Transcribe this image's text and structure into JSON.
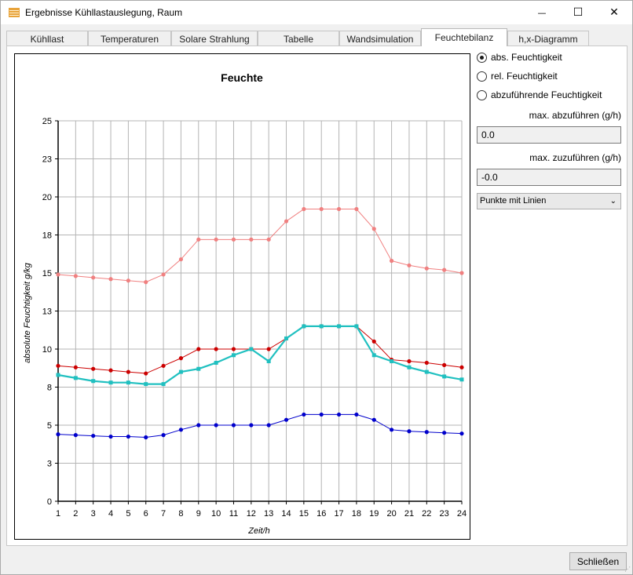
{
  "window": {
    "title": "Ergebnisse Kühllastauslegung, Raum",
    "minimize_glyph": "—",
    "maximize_glyph": "☐",
    "close_glyph": "✕",
    "app_icon": "app-grid-icon"
  },
  "tabs": [
    {
      "label": "Kühllast"
    },
    {
      "label": "Temperaturen"
    },
    {
      "label": "Solare Strahlung"
    },
    {
      "label": "Tabelle"
    },
    {
      "label": "Wandsimulation"
    },
    {
      "label": "Feuchtebilanz",
      "active": true
    },
    {
      "label": "h,x-Diagramm"
    }
  ],
  "options": {
    "radios": [
      {
        "label": "abs. Feuchtigkeit",
        "checked": true
      },
      {
        "label": "rel. Feuchtigkeit",
        "checked": false
      },
      {
        "label": "abzuführende Feuchtigkeit",
        "checked": false
      }
    ],
    "max_remove_label": "max. abzuführen (g/h)",
    "max_remove_value": "0.0",
    "max_add_label": "max. zuzuführen (g/h)",
    "max_add_value": "-0.0",
    "display_mode": "Punkte mit Linien"
  },
  "footer": {
    "close_label": "Schließen"
  },
  "chart_data": {
    "type": "line",
    "title": "Feuchte",
    "xlabel": "Zeit/h",
    "ylabel": "absolute Feuchtigkeit g/kg",
    "x": [
      1,
      2,
      3,
      4,
      5,
      6,
      7,
      8,
      9,
      10,
      11,
      12,
      13,
      14,
      15,
      16,
      17,
      18,
      19,
      20,
      21,
      22,
      23,
      24
    ],
    "xlim": [
      1,
      24
    ],
    "ylim": [
      0,
      25
    ],
    "yticks": [
      0,
      3,
      5,
      8,
      10,
      13,
      15,
      18,
      20,
      23,
      25
    ],
    "grid": true,
    "series": [
      {
        "color": "#f08080",
        "marker": "circle",
        "values": [
          14.9,
          14.8,
          14.7,
          14.6,
          14.5,
          14.4,
          14.9,
          15.9,
          17.2,
          17.2,
          17.2,
          17.2,
          17.2,
          18.4,
          19.2,
          19.2,
          19.2,
          19.2,
          17.9,
          15.8,
          15.5,
          15.3,
          15.2,
          15.0
        ]
      },
      {
        "color": "#cc0000",
        "marker": "circle",
        "values": [
          8.9,
          8.8,
          8.7,
          8.6,
          8.5,
          8.4,
          8.9,
          9.4,
          10.0,
          10.0,
          10.0,
          10.0,
          10.0,
          10.7,
          11.5,
          11.5,
          11.5,
          11.5,
          10.5,
          9.3,
          9.2,
          9.1,
          8.95,
          8.8
        ]
      },
      {
        "color": "#20c0c0",
        "marker": "square",
        "values": [
          8.3,
          8.1,
          7.9,
          7.8,
          7.8,
          7.7,
          7.7,
          8.5,
          8.7,
          9.1,
          9.6,
          10.0,
          9.2,
          10.7,
          11.5,
          11.5,
          11.5,
          11.5,
          9.6,
          9.2,
          8.8,
          8.5,
          8.2,
          8.0
        ]
      },
      {
        "color": "#0000cc",
        "marker": "circle",
        "values": [
          4.4,
          4.35,
          4.3,
          4.25,
          4.25,
          4.2,
          4.35,
          4.7,
          5.0,
          5.0,
          5.0,
          5.0,
          5.0,
          5.35,
          5.7,
          5.7,
          5.7,
          5.7,
          5.35,
          4.7,
          4.6,
          4.55,
          4.5,
          4.45
        ]
      }
    ]
  }
}
